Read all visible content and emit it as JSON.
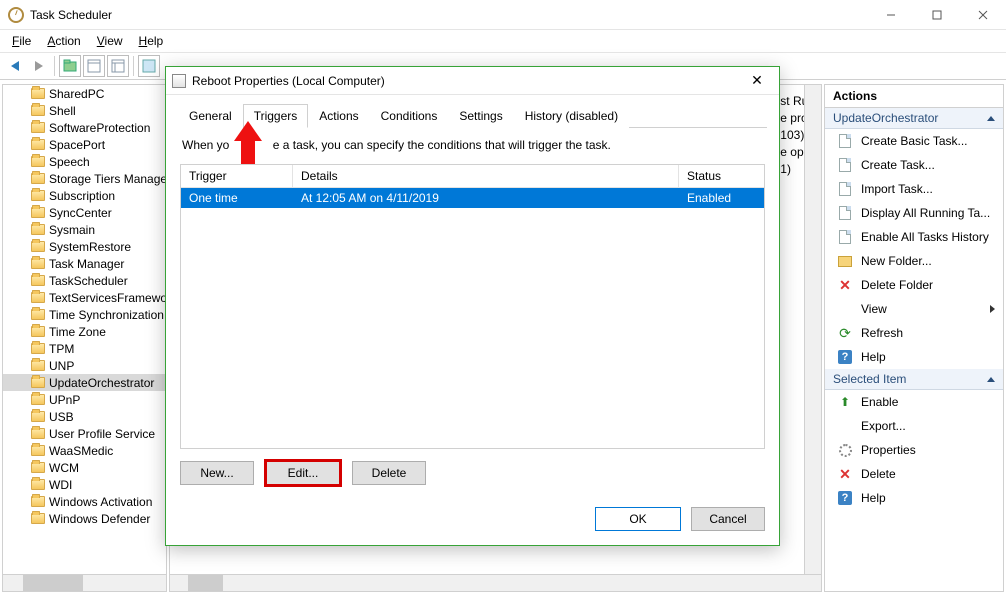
{
  "window": {
    "title": "Task Scheduler",
    "menus": {
      "file": "File",
      "action": "Action",
      "view": "View",
      "help": "Help"
    },
    "winbtn": {
      "min": "Minimize",
      "max": "Maximize",
      "close": "Close"
    }
  },
  "tree": {
    "items": [
      "SharedPC",
      "Shell",
      "SoftwareProtection",
      "SpacePort",
      "Speech",
      "Storage Tiers Management",
      "Subscription",
      "SyncCenter",
      "Sysmain",
      "SystemRestore",
      "Task Manager",
      "TaskScheduler",
      "TextServicesFramework",
      "Time Synchronization",
      "Time Zone",
      "TPM",
      "UNP",
      "UpdateOrchestrator",
      "UPnP",
      "USB",
      "User Profile Service",
      "WaaSMedic",
      "WCM",
      "WDI",
      "Windows Activation",
      "Windows Defender"
    ],
    "selected_index": 17
  },
  "center_peek": {
    "l1": "st Run",
    "l2": "e proc",
    "l3": "103)",
    "l4": "e open",
    "l5": "1)"
  },
  "actions": {
    "header": "Actions",
    "group1": "UpdateOrchestrator",
    "items1": [
      "Create Basic Task...",
      "Create Task...",
      "Import Task...",
      "Display All Running Ta...",
      "Enable All Tasks History",
      "New Folder...",
      "Delete Folder",
      "View",
      "Refresh",
      "Help"
    ],
    "group2": "Selected Item",
    "items2": [
      "Enable",
      "Export...",
      "Properties",
      "Delete",
      "Help"
    ]
  },
  "dialog": {
    "title": "Reboot Properties (Local Computer)",
    "tabs": {
      "general": "General",
      "triggers": "Triggers",
      "actions": "Actions",
      "conditions": "Conditions",
      "settings": "Settings",
      "history": "History (disabled)"
    },
    "desc_prefix": "When yo",
    "desc_suffix": "e a task, you can specify the conditions that will trigger the task.",
    "table": {
      "h1": "Trigger",
      "h2": "Details",
      "h3": "Status",
      "r1c1": "One time",
      "r1c2": "At 12:05 AM on 4/11/2019",
      "r1c3": "Enabled"
    },
    "btn_new": "New...",
    "btn_edit": "Edit...",
    "btn_delete": "Delete",
    "btn_ok": "OK",
    "btn_cancel": "Cancel"
  }
}
